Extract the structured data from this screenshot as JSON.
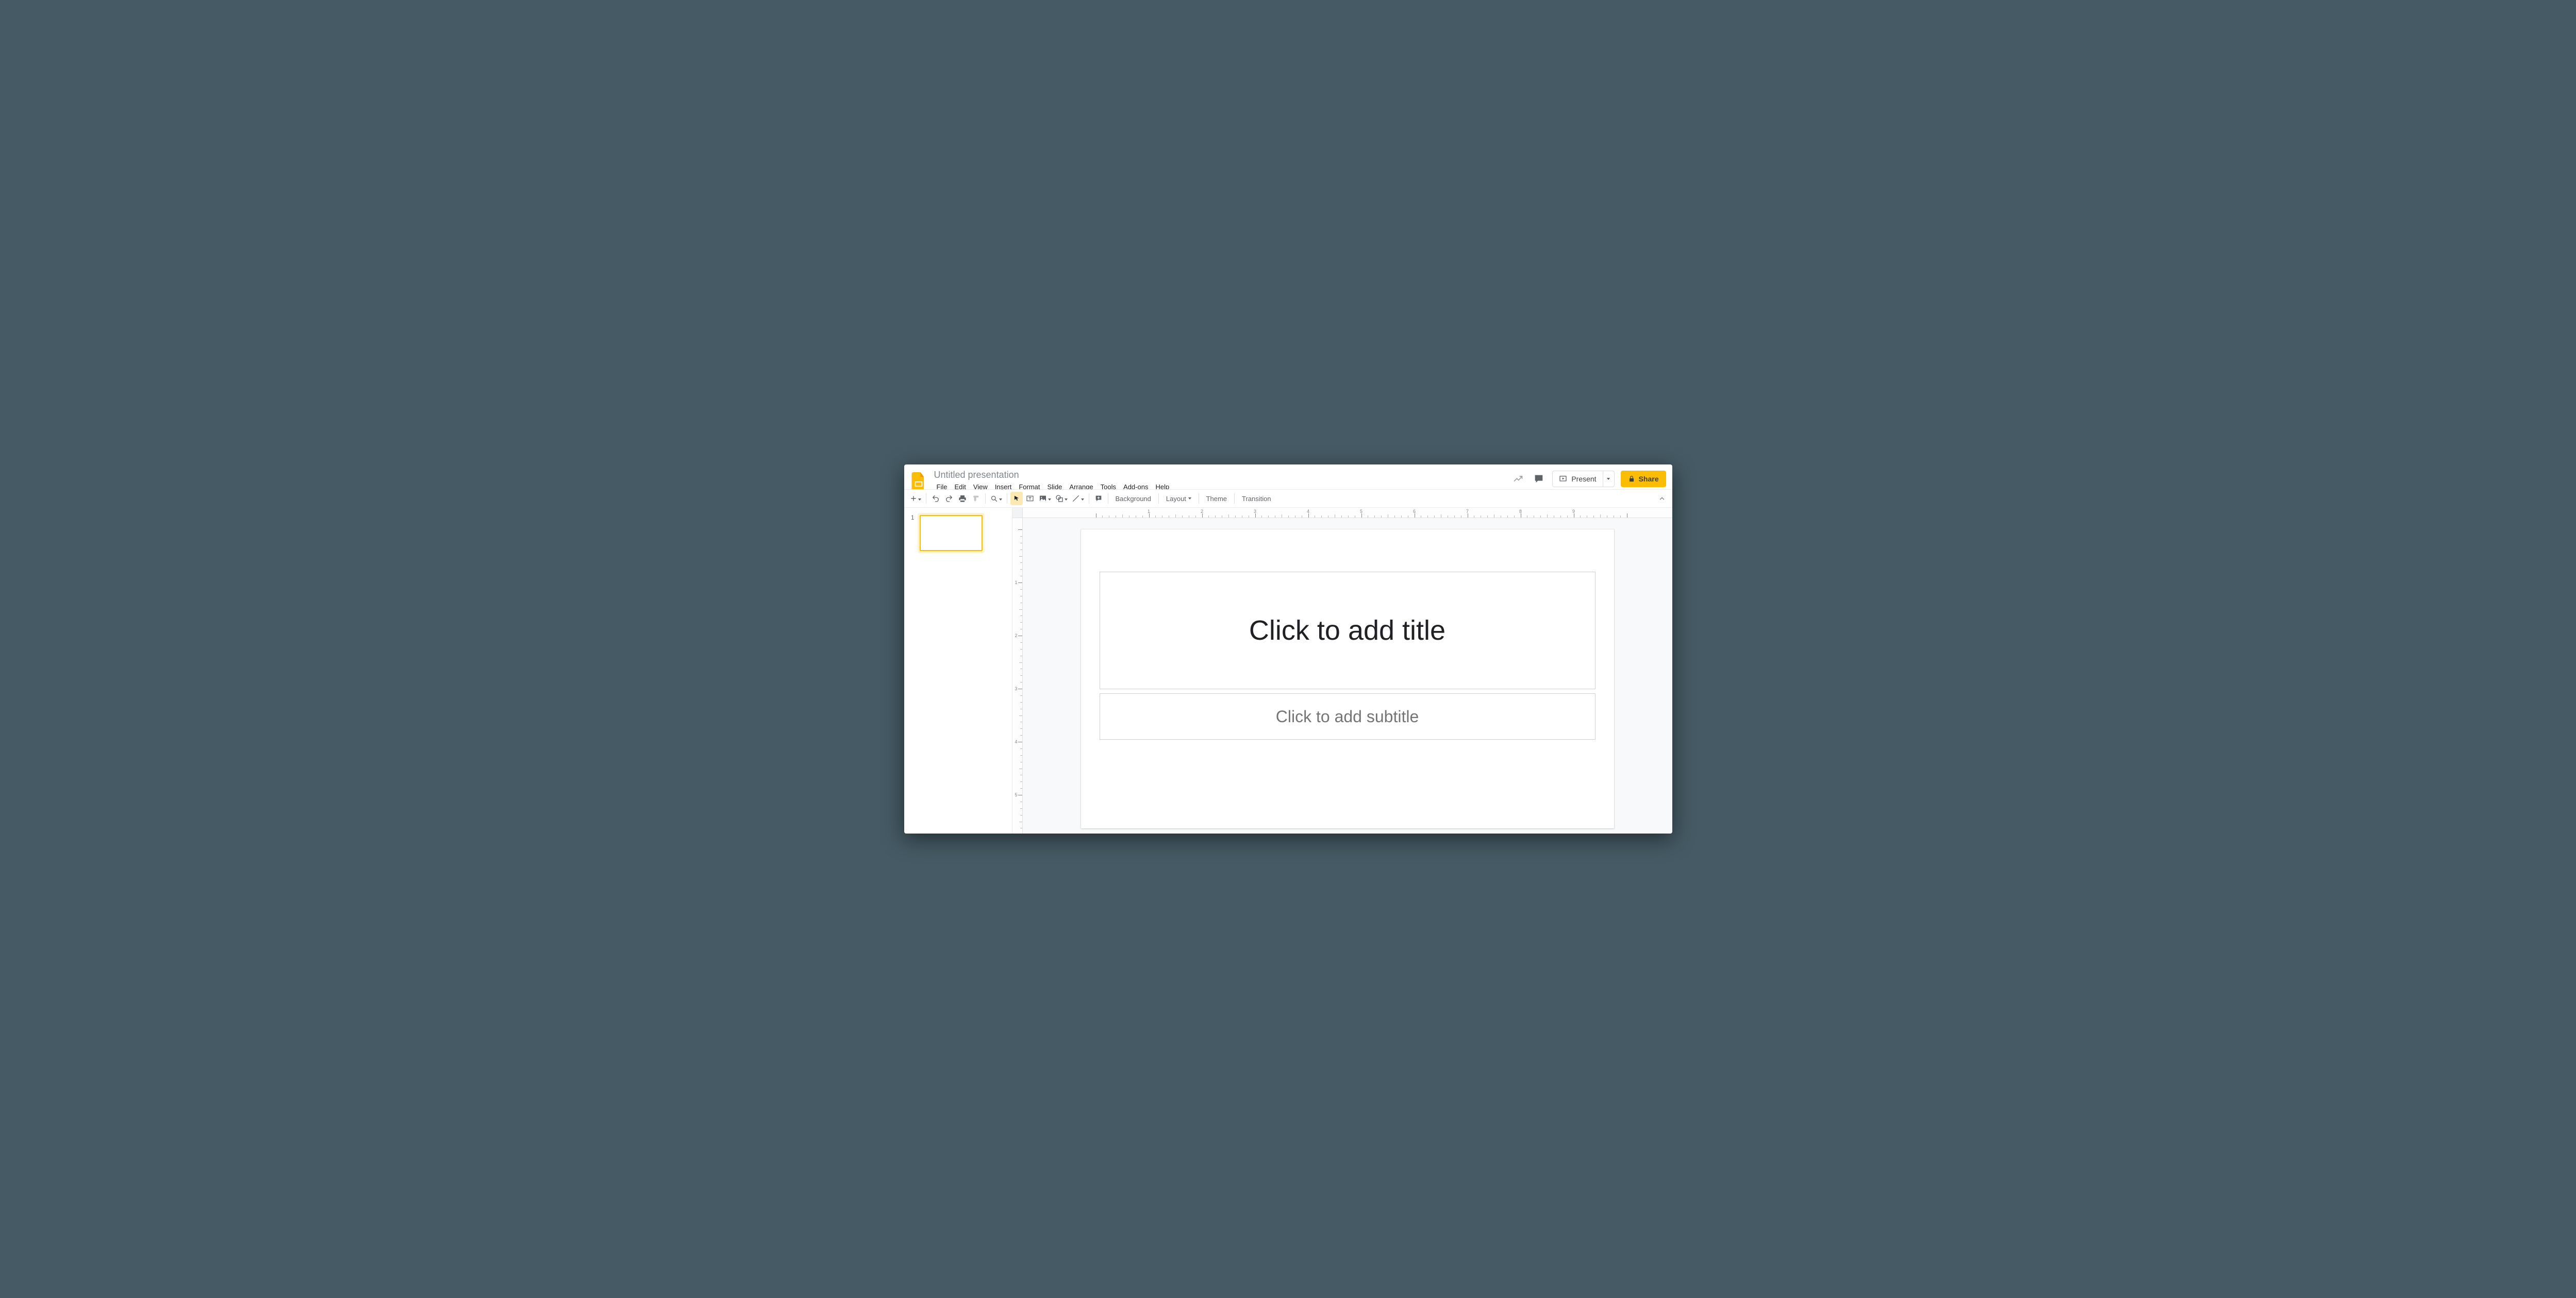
{
  "header": {
    "doc_title": "Untitled presentation",
    "menus": [
      "File",
      "Edit",
      "View",
      "Insert",
      "Format",
      "Slide",
      "Arrange",
      "Tools",
      "Add-ons",
      "Help"
    ],
    "present_label": "Present",
    "share_label": "Share"
  },
  "toolbar": {
    "background_label": "Background",
    "layout_label": "Layout",
    "theme_label": "Theme",
    "transition_label": "Transition"
  },
  "filmstrip": {
    "slides": [
      {
        "number": "1"
      }
    ]
  },
  "canvas": {
    "title_placeholder": "Click to add title",
    "subtitle_placeholder": "Click to add subtitle",
    "h_ruler_labels": [
      "1",
      "2",
      "3",
      "4",
      "5",
      "6",
      "7",
      "8",
      "9"
    ],
    "v_ruler_labels": [
      "1",
      "2",
      "3",
      "4",
      "5"
    ]
  }
}
